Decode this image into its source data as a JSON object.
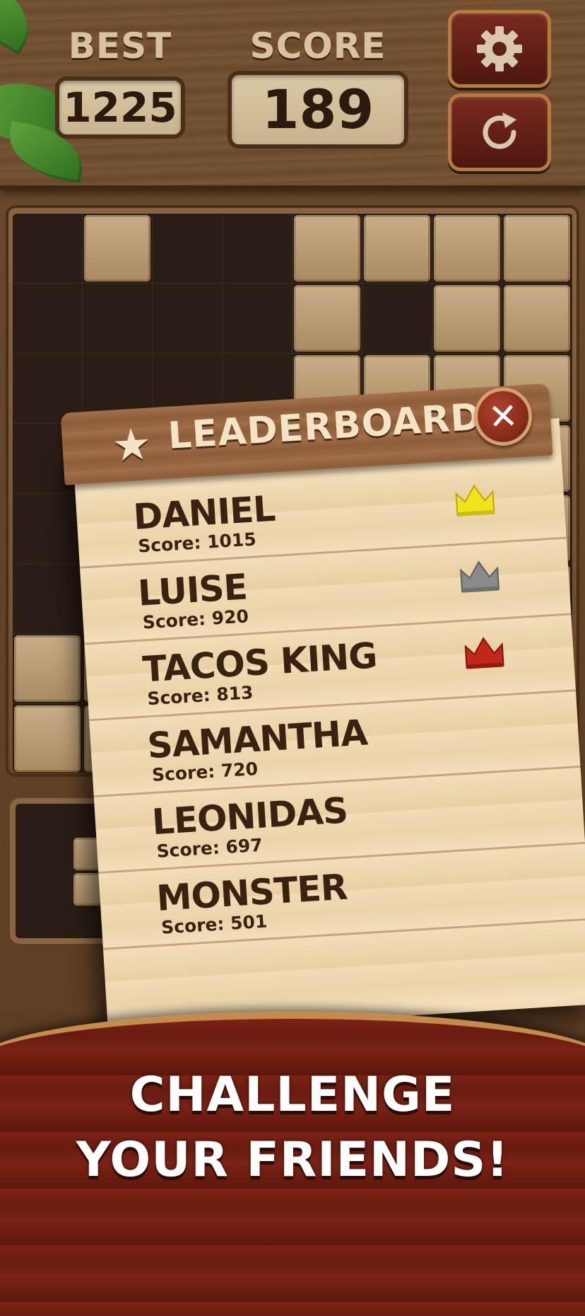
{
  "header": {
    "best_label": "BEST",
    "best_value": "1225",
    "score_label": "SCORE",
    "score_value": "189",
    "settings_icon": "gear-icon",
    "restart_icon": "restart-icon"
  },
  "leaderboard": {
    "title": "LEADERBOARD",
    "close_icon": "close-icon",
    "entries": [
      {
        "name": "DANIEL",
        "score": "Score: 1015",
        "crown": "gold"
      },
      {
        "name": "LUISE",
        "score": "Score: 920",
        "crown": "silver"
      },
      {
        "name": "TACOS KING",
        "score": "Score: 813",
        "crown": "bronze"
      },
      {
        "name": "SAMANTHA",
        "score": "Score: 720",
        "crown": ""
      },
      {
        "name": "LEONIDAS",
        "score": "Score: 697",
        "crown": ""
      },
      {
        "name": "MONSTER",
        "score": "Score: 501",
        "crown": ""
      }
    ]
  },
  "banner": {
    "line1": "CHALLENGE",
    "line2": "YOUR FRIENDS!"
  },
  "colors": {
    "gold_crown": "#f2e21a",
    "silver_crown": "#8a8a8a",
    "bronze_crown": "#c0281b"
  }
}
